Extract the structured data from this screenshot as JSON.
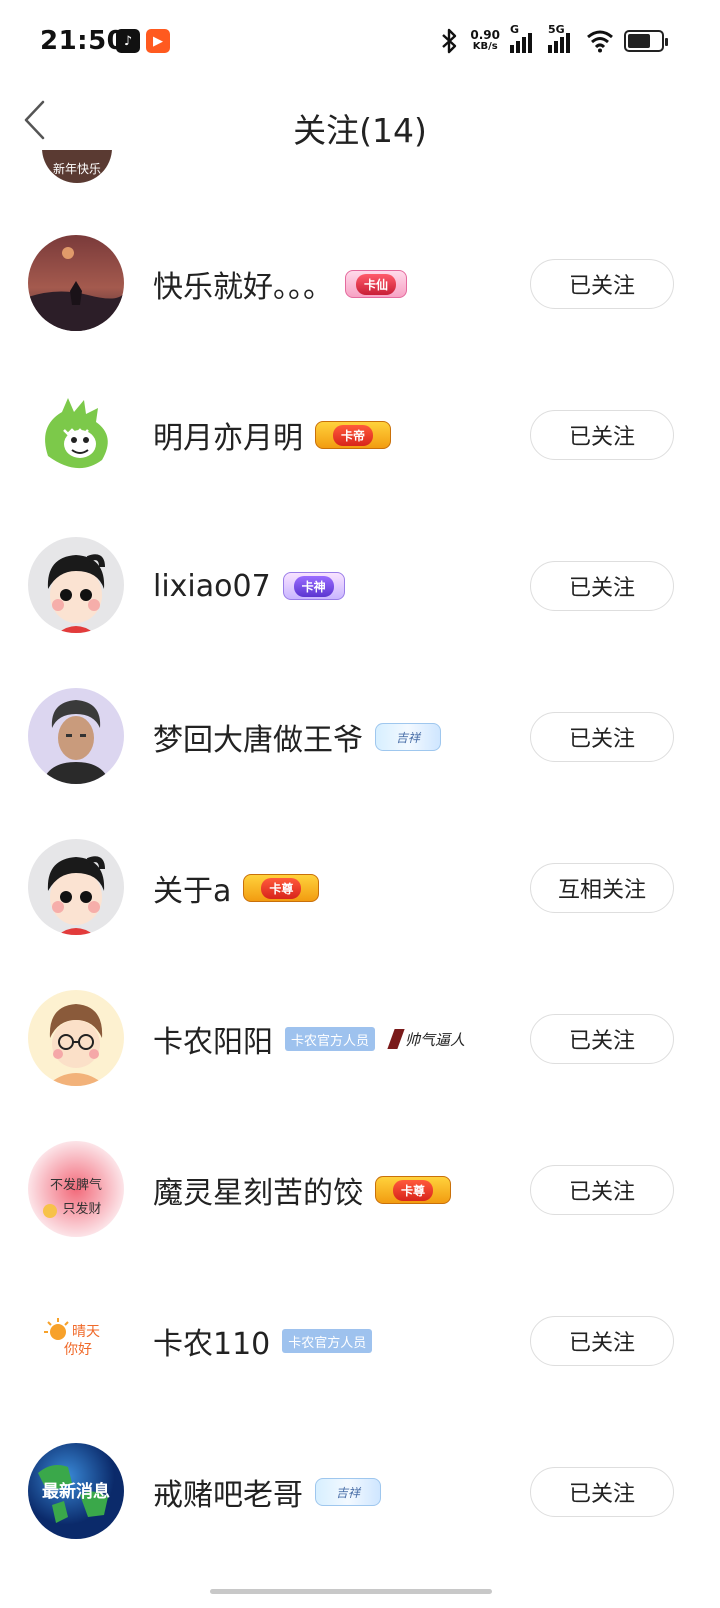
{
  "status_bar": {
    "time": "21:50",
    "net_speed_value": "0.90",
    "net_speed_unit": "KB/s",
    "signal1_label": "G",
    "signal2_label": "5G",
    "icons": [
      "music-app-icon",
      "video-app-icon",
      "bluetooth-icon",
      "wifi-icon",
      "battery-icon"
    ]
  },
  "header": {
    "title": "关注(14)",
    "back_icon": "chevron-left-icon"
  },
  "partial_avatar_text": "新年快乐",
  "follow_list": [
    {
      "name": "快乐就好。。。",
      "badges": [
        {
          "type": "pink",
          "text": "卡仙"
        }
      ],
      "button": "已关注",
      "avatar": "sunset"
    },
    {
      "name": "明月亦月明",
      "badges": [
        {
          "type": "gold",
          "text": "卡帝"
        }
      ],
      "button": "已关注",
      "avatar": "dino"
    },
    {
      "name": "lixiao07",
      "badges": [
        {
          "type": "purple",
          "text": "卡神"
        }
      ],
      "button": "已关注",
      "avatar": "cartoon"
    },
    {
      "name": "梦回大唐做王爷",
      "badges": [
        {
          "type": "cloud",
          "text": "吉祥"
        }
      ],
      "button": "已关注",
      "avatar": "man"
    },
    {
      "name": "关于a",
      "badges": [
        {
          "type": "gold",
          "text": "卡尊"
        }
      ],
      "button": "互相关注",
      "avatar": "cartoon"
    },
    {
      "name": "卡农阳阳",
      "badges": [
        {
          "type": "official",
          "text": "卡农官方人员"
        },
        {
          "type": "calligraphy",
          "text": "帅气逼人"
        }
      ],
      "button": "已关注",
      "avatar": "glasses"
    },
    {
      "name": "魔灵星刻苦的饺",
      "badges": [
        {
          "type": "gold",
          "text": "卡尊"
        }
      ],
      "button": "已关注",
      "avatar": "text"
    },
    {
      "name": "卡农110",
      "badges": [
        {
          "type": "official",
          "text": "卡农官方人员"
        }
      ],
      "button": "已关注",
      "avatar": "sunny"
    },
    {
      "name": "戒赌吧老哥",
      "badges": [
        {
          "type": "cloud",
          "text": "吉祥"
        }
      ],
      "button": "已关注",
      "avatar": "globe"
    }
  ],
  "avatar_texts": {
    "text_line1": "不发脾气",
    "text_line2": "只发财",
    "sunny_line1": "晴天",
    "sunny_line2": "你好",
    "globe_text": "最新消息"
  }
}
